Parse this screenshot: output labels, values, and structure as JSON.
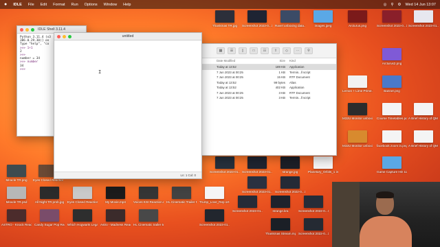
{
  "menubar": {
    "apple": "",
    "app": "IDLE",
    "items": [
      "File",
      "Edit",
      "Format",
      "Run",
      "Options",
      "Window",
      "Help"
    ],
    "clock": "Wed 14 Jun 13:07"
  },
  "shell": {
    "title": "IDLE Shell 3.11.4",
    "lines": [
      "Python 3.11.4 (v3",
      "306.0.29.30)] on",
      "Type \"help\", \"co",
      ">>> 1+1",
      "2",
      ">>>",
      "number = 34",
      ">>> number",
      "34",
      ">>>"
    ]
  },
  "editor": {
    "title": "untitled",
    "status": "Ln: 1  Col: 0"
  },
  "finder": {
    "columns": [
      "Date Modified",
      "Size",
      "Kind"
    ],
    "rows": [
      {
        "date": "Today at 13:52",
        "size": "189 KB",
        "kind": "Application",
        "selected": true
      },
      {
        "date": "7 Jun 2023 at 00:25",
        "size": "1 KB",
        "kind": "Termin...ll script",
        "selected": false
      },
      {
        "date": "7 Jun 2023 at 00:25",
        "size": "15 KB",
        "kind": "RTF Document",
        "selected": false
      },
      {
        "date": "Today at 13:52",
        "size": "99 bytes",
        "kind": "Alias",
        "selected": false
      },
      {
        "date": "Today at 13:52",
        "size": "402 KB",
        "kind": "Application",
        "selected": false
      },
      {
        "date": "7 Jun 2023 at 00:25",
        "size": "3 KB",
        "kind": "RTF Document",
        "selected": false
      },
      {
        "date": "7 Jun 2023 at 00:25",
        "size": "3 KB",
        "kind": "Termin...ll script",
        "selected": false
      }
    ]
  },
  "desktop_icons": [
    {
      "label": "Thankmas TR.jpg"
    },
    {
      "label": "Screenshot 2023-0...12.53.58"
    },
    {
      "label": "Ravel unboxing data..."
    },
    {
      "label": "images.jpeg"
    },
    {
      "label": "Arcturus.png"
    },
    {
      "label": "Screenshot 2023-0...12.12.58.55"
    },
    {
      "label": "Screenshot 2023-01...15.10.49"
    },
    {
      "label": "Arcturus2.png"
    },
    {
      "label": "Lemon + Lime Prime.data"
    },
    {
      "label": "Banner.png"
    },
    {
      "label": "M32U Monitor unboxing_data"
    },
    {
      "label": "Course Timetables.pdf.jpg"
    },
    {
      "label": "A Brief History of QM 14.audio.wav"
    },
    {
      "label": "M32U Monitor unboxing_mp4"
    },
    {
      "label": "facebook zoom in.png"
    },
    {
      "label": "A Brief History of QM 2Audio.wav"
    },
    {
      "label": "Screenshot 2023-01...14.15.41"
    },
    {
      "label": "Screenshot 2023-01...13.54.43"
    },
    {
      "label": "Planetary_Orbits_1 in_Binary_...last.pdf"
    },
    {
      "label": "Game Capture HD 11 ...Update"
    },
    {
      "label": "Miracle TR.png"
    },
    {
      "label": "Eyes Closed Reaction 2.mp4"
    },
    {
      "label": "Screenshot 2023-01...13.54.43"
    },
    {
      "label": "strange.jpg"
    },
    {
      "label": "Screenshot 2022-0...12.31.31"
    },
    {
      "label": "Miracle TR.psd"
    },
    {
      "label": "All Night TR prob.jpg"
    },
    {
      "label": "Eyes Closed Reaction TR.psd"
    },
    {
      "label": "My Movie.mp4"
    },
    {
      "label": "Voices KSI Reaction.mp4"
    },
    {
      "label": "HL Cinematic Trailer R...tion.mp4"
    },
    {
      "label": "Trump_Love_Rep ort-2.pdf"
    },
    {
      "label": "Screenshot 2023-01...15.50.23"
    },
    {
      "label": "strange.kra"
    },
    {
      "label": "Screenshot 2022-0...16.28.55"
    },
    {
      "label": "ASTRO - Knock Reaction 55.jpg"
    },
    {
      "label": "Candy Sugar Pop Reaction.mp4"
    },
    {
      "label": "Which Hogwarts Legacy...ward.mp4"
    },
    {
      "label": "Astro - Madness Reaction TR.jpg"
    },
    {
      "label": "HL Cinematic trailer 53.jpg"
    },
    {
      "label": "Screenshot 2023-01...13.55.33"
    },
    {
      "label": "Thankmas Stream.mp4"
    },
    {
      "label": "Screenshot 2022-0...12.32.46"
    }
  ]
}
